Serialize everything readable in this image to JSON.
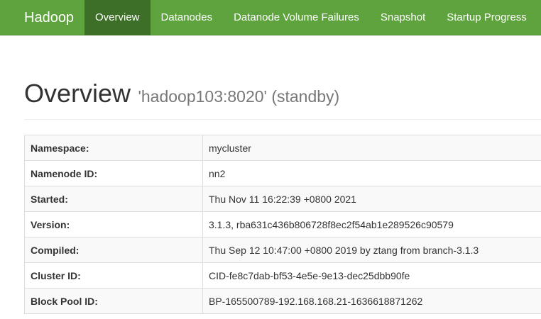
{
  "navbar": {
    "brand": "Hadoop",
    "items": [
      {
        "label": "Overview",
        "active": true
      },
      {
        "label": "Datanodes",
        "active": false
      },
      {
        "label": "Datanode Volume Failures",
        "active": false
      },
      {
        "label": "Snapshot",
        "active": false
      },
      {
        "label": "Startup Progress",
        "active": false
      }
    ]
  },
  "header": {
    "title": "Overview",
    "subtitle": "'hadoop103:8020' (standby)"
  },
  "info": [
    {
      "key": "Namespace:",
      "value": "mycluster"
    },
    {
      "key": "Namenode ID:",
      "value": "nn2"
    },
    {
      "key": "Started:",
      "value": "Thu Nov 11 16:22:39 +0800 2021"
    },
    {
      "key": "Version:",
      "value": "3.1.3, rba631c436b806728f8ec2f54ab1e289526c90579"
    },
    {
      "key": "Compiled:",
      "value": "Thu Sep 12 10:47:00 +0800 2019 by ztang from branch-3.1.3"
    },
    {
      "key": "Cluster ID:",
      "value": "CID-fe8c7dab-bf53-4e5e-9e13-dec25dbb90fe"
    },
    {
      "key": "Block Pool ID:",
      "value": "BP-165500789-192.168.168.21-1636618871262"
    }
  ],
  "colors": {
    "navbar": "#5fa33e",
    "nav_active": "#3e6f28",
    "table_stripe": "#f9f9f9",
    "border": "#dddddd"
  }
}
